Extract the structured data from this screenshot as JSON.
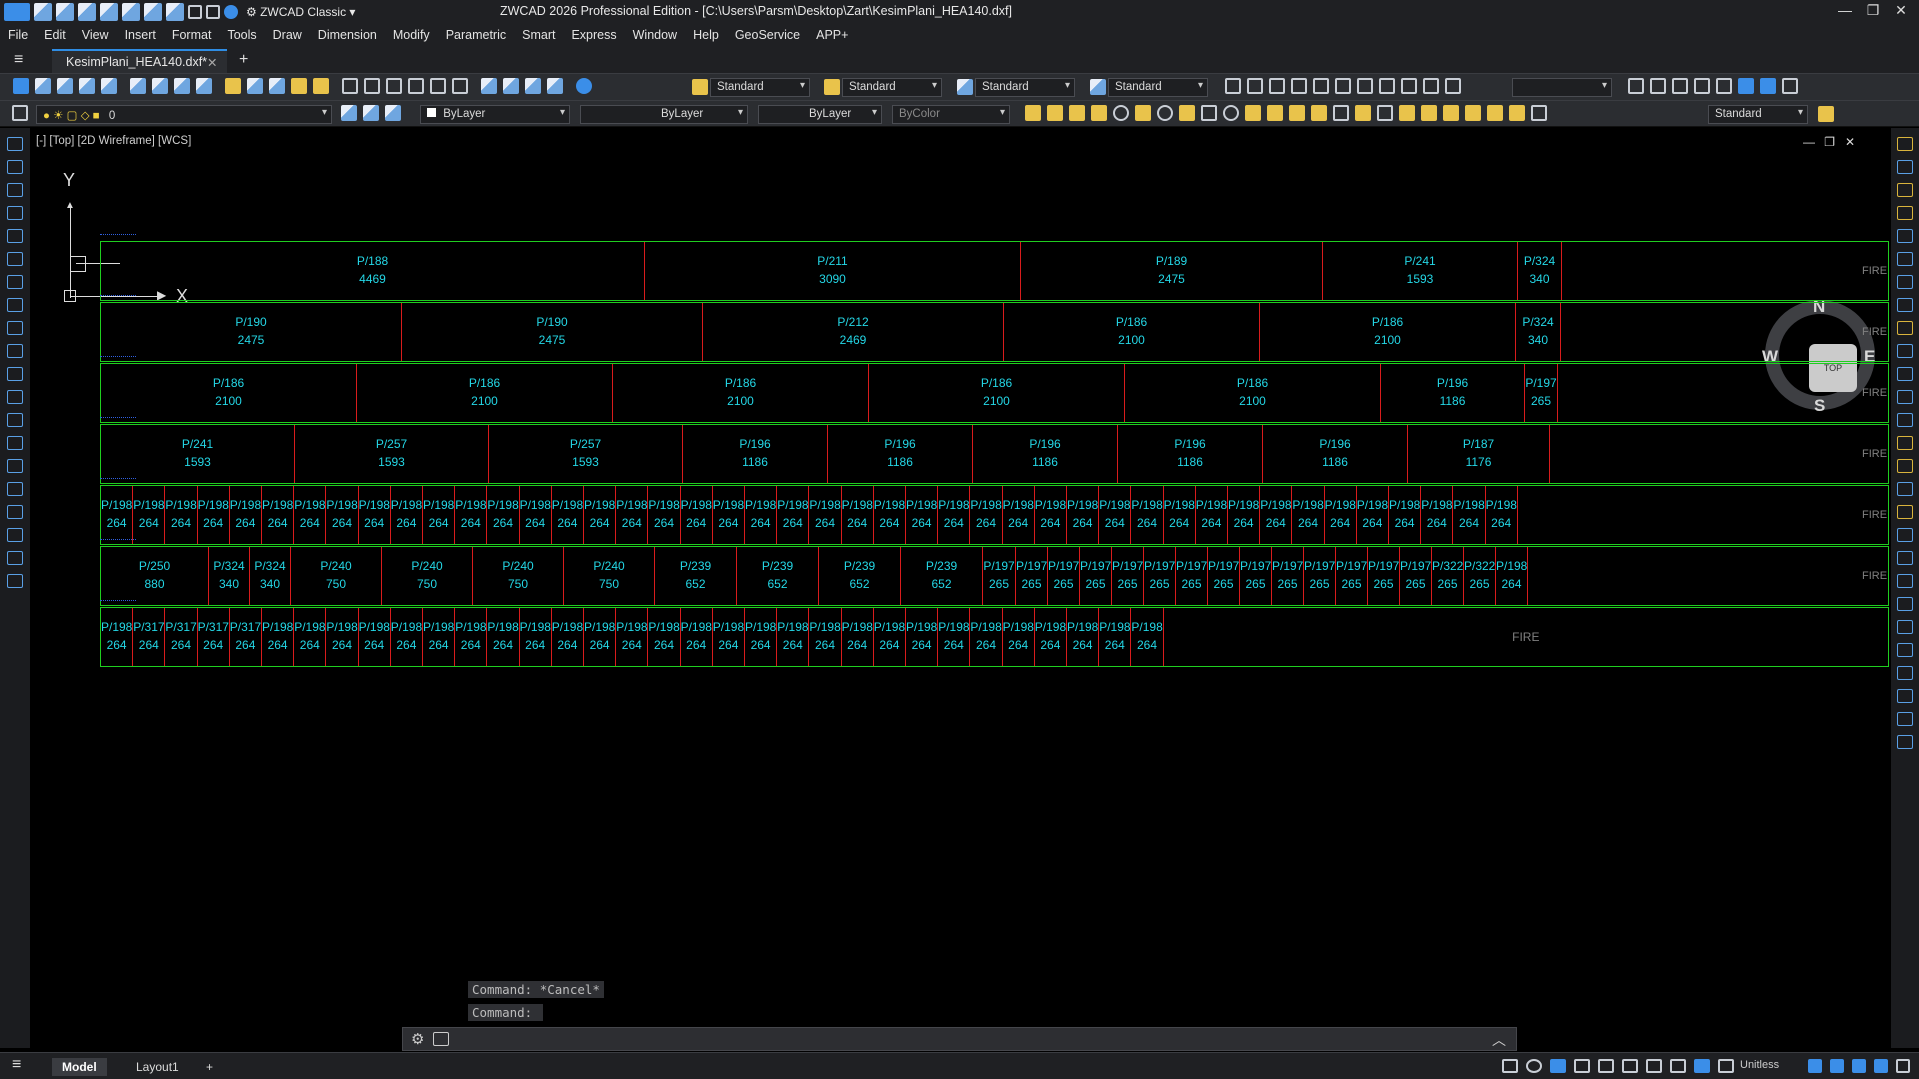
{
  "titlebar": {
    "workspace": "ZWCAD Classic",
    "title": "ZWCAD 2026 Professional Edition - [C:\\Users\\Parsm\\Desktop\\Zart\\KesimPlani_HEA140.dxf]"
  },
  "menu": [
    "File",
    "Edit",
    "View",
    "Insert",
    "Format",
    "Tools",
    "Draw",
    "Dimension",
    "Modify",
    "Parametric",
    "Smart",
    "Express",
    "Window",
    "Help",
    "GeoService",
    "APP+"
  ],
  "doc_tab": {
    "label": "KesimPlani_HEA140.dxf*",
    "close": "✕",
    "new": "+"
  },
  "toolbar1": {
    "text_style": "Standard",
    "dim_style": "Standard",
    "table_style": "Standard",
    "mleader_style": "Standard"
  },
  "toolbar2": {
    "layer": "0",
    "color": "ByLayer",
    "linetype": "ByLayer",
    "lineweight": "ByLayer",
    "plotstyle": "ByColor",
    "dim_style": "Standard"
  },
  "viewport": {
    "label": "[-] [Top] [2D Wireframe] [WCS]",
    "axis_x": "X",
    "axis_y": "Y"
  },
  "viewcube": {
    "n": "N",
    "s": "S",
    "e": "E",
    "w": "W",
    "face": "TOP"
  },
  "rows": [
    {
      "fire": "FIRE",
      "cells": [
        {
          "label": "P/188",
          "len": "4469"
        },
        {
          "label": "P/211",
          "len": "3090"
        },
        {
          "label": "P/189",
          "len": "2475"
        },
        {
          "label": "P/241",
          "len": "1593"
        },
        {
          "label": "P/324",
          "len": "340"
        }
      ]
    },
    {
      "fire": "FIRE",
      "cells": [
        {
          "label": "P/190",
          "len": "2475"
        },
        {
          "label": "P/190",
          "len": "2475"
        },
        {
          "label": "P/212",
          "len": "2469"
        },
        {
          "label": "P/186",
          "len": "2100"
        },
        {
          "label": "P/186",
          "len": "2100"
        },
        {
          "label": "P/324",
          "len": "340"
        }
      ]
    },
    {
      "fire": "FIRE",
      "cells": [
        {
          "label": "P/186",
          "len": "2100"
        },
        {
          "label": "P/186",
          "len": "2100"
        },
        {
          "label": "P/186",
          "len": "2100"
        },
        {
          "label": "P/186",
          "len": "2100"
        },
        {
          "label": "P/186",
          "len": "2100"
        },
        {
          "label": "P/196",
          "len": "1186"
        },
        {
          "label": "P/197",
          "len": "265"
        }
      ]
    },
    {
      "fire": "FIRE",
      "cells": [
        {
          "label": "P/241",
          "len": "1593"
        },
        {
          "label": "P/257",
          "len": "1593"
        },
        {
          "label": "P/257",
          "len": "1593"
        },
        {
          "label": "P/196",
          "len": "1186"
        },
        {
          "label": "P/196",
          "len": "1186"
        },
        {
          "label": "P/196",
          "len": "1186"
        },
        {
          "label": "P/196",
          "len": "1186"
        },
        {
          "label": "P/196",
          "len": "1186"
        },
        {
          "label": "P/187",
          "len": "1176"
        }
      ]
    },
    {
      "fire": "FIRE",
      "cells": [
        {
          "label": "P/198",
          "len": "264"
        },
        {
          "label": "P/198",
          "len": "264"
        },
        {
          "label": "P/198",
          "len": "264"
        },
        {
          "label": "P/198",
          "len": "264"
        },
        {
          "label": "P/198",
          "len": "264"
        },
        {
          "label": "P/198",
          "len": "264"
        },
        {
          "label": "P/198",
          "len": "264"
        },
        {
          "label": "P/198",
          "len": "264"
        },
        {
          "label": "P/198",
          "len": "264"
        },
        {
          "label": "P/198",
          "len": "264"
        },
        {
          "label": "P/198",
          "len": "264"
        },
        {
          "label": "P/198",
          "len": "264"
        },
        {
          "label": "P/198",
          "len": "264"
        },
        {
          "label": "P/198",
          "len": "264"
        },
        {
          "label": "P/198",
          "len": "264"
        },
        {
          "label": "P/198",
          "len": "264"
        },
        {
          "label": "P/198",
          "len": "264"
        },
        {
          "label": "P/198",
          "len": "264"
        },
        {
          "label": "P/198",
          "len": "264"
        },
        {
          "label": "P/198",
          "len": "264"
        },
        {
          "label": "P/198",
          "len": "264"
        },
        {
          "label": "P/198",
          "len": "264"
        },
        {
          "label": "P/198",
          "len": "264"
        },
        {
          "label": "P/198",
          "len": "264"
        },
        {
          "label": "P/198",
          "len": "264"
        },
        {
          "label": "P/198",
          "len": "264"
        },
        {
          "label": "P/198",
          "len": "264"
        },
        {
          "label": "P/198",
          "len": "264"
        },
        {
          "label": "P/198",
          "len": "264"
        },
        {
          "label": "P/198",
          "len": "264"
        },
        {
          "label": "P/198",
          "len": "264"
        },
        {
          "label": "P/198",
          "len": "264"
        },
        {
          "label": "P/198",
          "len": "264"
        },
        {
          "label": "P/198",
          "len": "264"
        },
        {
          "label": "P/198",
          "len": "264"
        },
        {
          "label": "P/198",
          "len": "264"
        },
        {
          "label": "P/198",
          "len": "264"
        },
        {
          "label": "P/198",
          "len": "264"
        },
        {
          "label": "P/198",
          "len": "264"
        },
        {
          "label": "P/198",
          "len": "264"
        },
        {
          "label": "P/198",
          "len": "264"
        },
        {
          "label": "P/198",
          "len": "264"
        },
        {
          "label": "P/198",
          "len": "264"
        },
        {
          "label": "P/198",
          "len": "264"
        }
      ]
    },
    {
      "fire": "FIRE",
      "cells": [
        {
          "label": "P/250",
          "len": "880"
        },
        {
          "label": "P/324",
          "len": "340"
        },
        {
          "label": "P/324",
          "len": "340"
        },
        {
          "label": "P/240",
          "len": "750"
        },
        {
          "label": "P/240",
          "len": "750"
        },
        {
          "label": "P/240",
          "len": "750"
        },
        {
          "label": "P/240",
          "len": "750"
        },
        {
          "label": "P/239",
          "len": "652"
        },
        {
          "label": "P/239",
          "len": "652"
        },
        {
          "label": "P/239",
          "len": "652"
        },
        {
          "label": "P/239",
          "len": "652"
        },
        {
          "label": "P/197",
          "len": "265"
        },
        {
          "label": "P/197",
          "len": "265"
        },
        {
          "label": "P/197",
          "len": "265"
        },
        {
          "label": "P/197",
          "len": "265"
        },
        {
          "label": "P/197",
          "len": "265"
        },
        {
          "label": "P/197",
          "len": "265"
        },
        {
          "label": "P/197",
          "len": "265"
        },
        {
          "label": "P/197",
          "len": "265"
        },
        {
          "label": "P/197",
          "len": "265"
        },
        {
          "label": "P/197",
          "len": "265"
        },
        {
          "label": "P/197",
          "len": "265"
        },
        {
          "label": "P/197",
          "len": "265"
        },
        {
          "label": "P/197",
          "len": "265"
        },
        {
          "label": "P/197",
          "len": "265"
        },
        {
          "label": "P/322",
          "len": "265"
        },
        {
          "label": "P/322",
          "len": "265"
        },
        {
          "label": "P/198",
          "len": "264"
        }
      ]
    },
    {
      "fire": "FIRE",
      "cells": [
        {
          "label": "P/198",
          "len": "264"
        },
        {
          "label": "P/317",
          "len": "264"
        },
        {
          "label": "P/317",
          "len": "264"
        },
        {
          "label": "P/317",
          "len": "264"
        },
        {
          "label": "P/317",
          "len": "264"
        },
        {
          "label": "P/198",
          "len": "264"
        },
        {
          "label": "P/198",
          "len": "264"
        },
        {
          "label": "P/198",
          "len": "264"
        },
        {
          "label": "P/198",
          "len": "264"
        },
        {
          "label": "P/198",
          "len": "264"
        },
        {
          "label": "P/198",
          "len": "264"
        },
        {
          "label": "P/198",
          "len": "264"
        },
        {
          "label": "P/198",
          "len": "264"
        },
        {
          "label": "P/198",
          "len": "264"
        },
        {
          "label": "P/198",
          "len": "264"
        },
        {
          "label": "P/198",
          "len": "264"
        },
        {
          "label": "P/198",
          "len": "264"
        },
        {
          "label": "P/198",
          "len": "264"
        },
        {
          "label": "P/198",
          "len": "264"
        },
        {
          "label": "P/198",
          "len": "264"
        },
        {
          "label": "P/198",
          "len": "264"
        },
        {
          "label": "P/198",
          "len": "264"
        },
        {
          "label": "P/198",
          "len": "264"
        },
        {
          "label": "P/198",
          "len": "264"
        },
        {
          "label": "P/198",
          "len": "264"
        },
        {
          "label": "P/198",
          "len": "264"
        },
        {
          "label": "P/198",
          "len": "264"
        },
        {
          "label": "P/198",
          "len": "264"
        },
        {
          "label": "P/198",
          "len": "264"
        },
        {
          "label": "P/198",
          "len": "264"
        },
        {
          "label": "P/198",
          "len": "264"
        },
        {
          "label": "P/198",
          "len": "264"
        },
        {
          "label": "P/198",
          "len": "264"
        }
      ]
    }
  ],
  "command": {
    "line1": "Command: *Cancel*",
    "line2": "Command:"
  },
  "status": {
    "model_tab": "Model",
    "layout_tab": "Layout1",
    "add": "+",
    "units": "Unitless"
  }
}
